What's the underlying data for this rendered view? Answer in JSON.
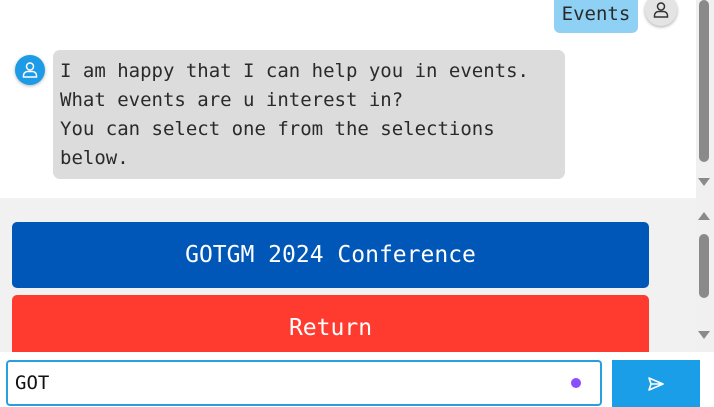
{
  "chat": {
    "user_message": "Events",
    "bot_message_lines": [
      "I am happy that I can help you in events.",
      "What events are u interest in?",
      "You can select one from the selections",
      "below."
    ]
  },
  "options": {
    "items": [
      {
        "label": "GOTGM 2024 Conference"
      },
      {
        "label": "Return"
      }
    ]
  },
  "input": {
    "value": "GOT"
  },
  "icons": {
    "user_avatar": "person-icon",
    "bot_avatar": "person-icon",
    "send": "send-arrow-icon"
  },
  "colors": {
    "accent": "#1a9ee8",
    "primary_option": "#0057b8",
    "return_option": "#ff3b30",
    "user_bubble": "#8fd0f5",
    "bot_bubble": "#dcdcdc"
  }
}
